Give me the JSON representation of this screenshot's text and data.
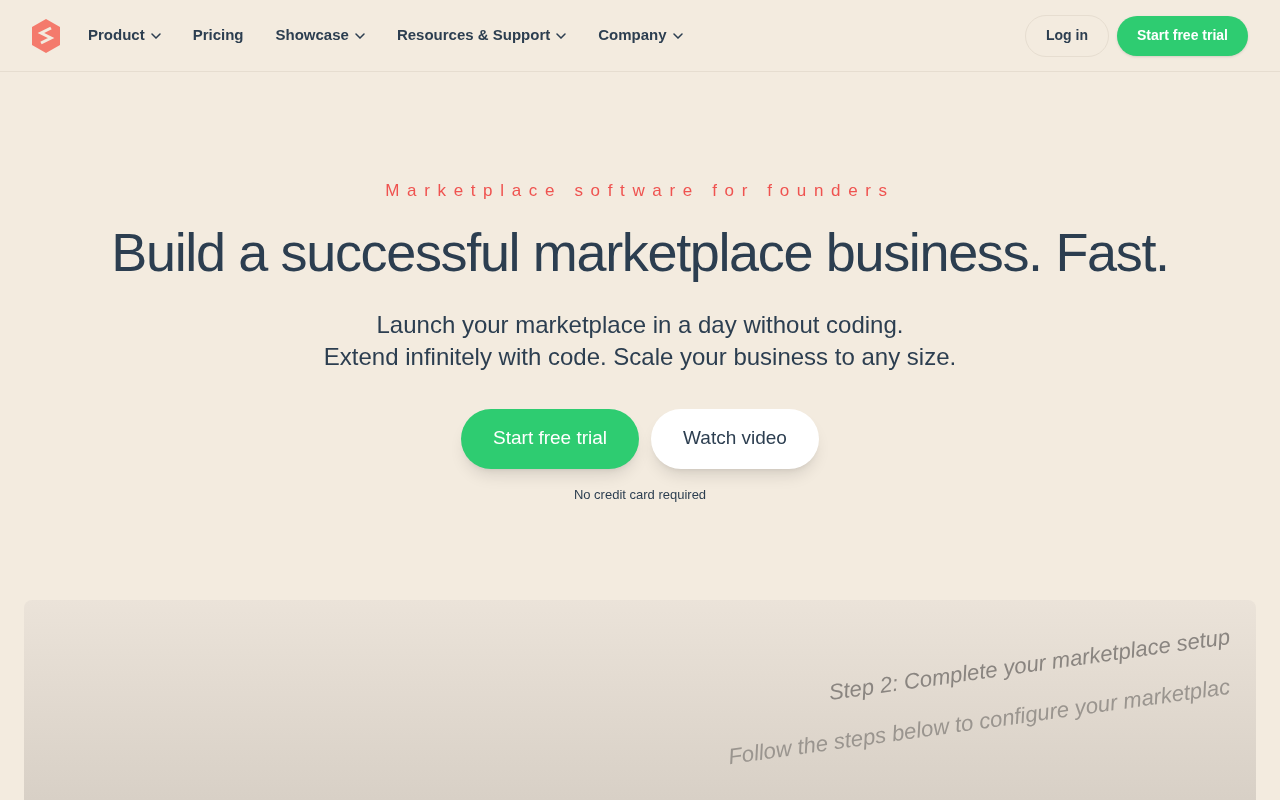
{
  "nav": {
    "items": [
      {
        "label": "Product",
        "dropdown": true
      },
      {
        "label": "Pricing",
        "dropdown": false
      },
      {
        "label": "Showcase",
        "dropdown": true
      },
      {
        "label": "Resources & Support",
        "dropdown": true
      },
      {
        "label": "Company",
        "dropdown": true
      }
    ],
    "login": "Log in",
    "cta": "Start free trial"
  },
  "hero": {
    "eyebrow": "Marketplace software for founders",
    "title": "Build a successful marketplace business. Fast.",
    "subtitle_lines": [
      "Launch your marketplace in a day without coding.",
      "Extend infinitely with code. Scale your business to any size."
    ],
    "primary": "Start free trial",
    "secondary": "Watch video",
    "note": "No credit card required"
  },
  "preview": {
    "heading": "Step 2: Complete your marketplace setup",
    "body": "Follow the steps below to configure your marketplac"
  }
}
